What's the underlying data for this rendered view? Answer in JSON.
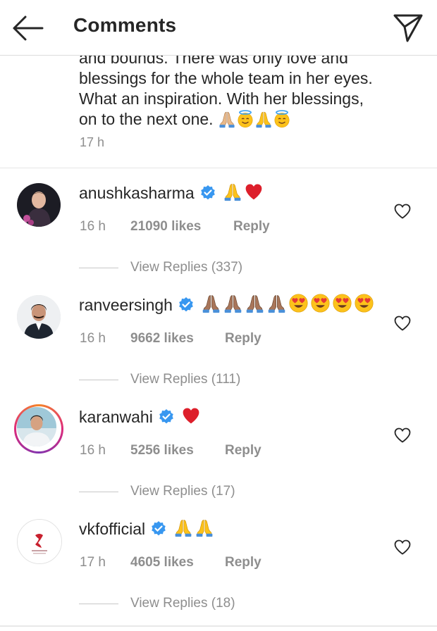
{
  "header": {
    "title": "Comments",
    "back_icon": "arrow-left-icon",
    "share_icon": "paper-plane-icon"
  },
  "caption": {
    "lines": [
      "and bounds. There was only love and",
      "blessings for the whole team in her eyes.",
      "What an inspiration. With her blessings,",
      "on to the next one."
    ],
    "emojis": [
      "folded-hands",
      "smiling-halo",
      "folded-hands",
      "smiling-halo"
    ],
    "time": "17 h"
  },
  "comments": [
    {
      "username": "anushkasharma",
      "verified": true,
      "emojis": [
        "folded-hands",
        "red-heart"
      ],
      "time": "16 h",
      "likes": "21090 likes",
      "reply": "Reply",
      "view_replies": "View Replies (337)"
    },
    {
      "username": "ranveersingh",
      "verified": true,
      "emojis": [
        "folded-hands-dark",
        "folded-hands-dark",
        "folded-hands-dark",
        "folded-hands-dark",
        "heart-eyes",
        "heart-eyes",
        "heart-eyes",
        "heart-eyes"
      ],
      "time": "16 h",
      "likes": "9662 likes",
      "reply": "Reply",
      "view_replies": "View Replies (111)"
    },
    {
      "username": "karanwahi",
      "verified": true,
      "emojis": [
        "red-heart"
      ],
      "time": "16 h",
      "likes": "5256 likes",
      "reply": "Reply",
      "view_replies": "View Replies (17)"
    },
    {
      "username": "vkfofficial",
      "verified": true,
      "emojis": [
        "folded-hands",
        "folded-hands"
      ],
      "time": "17 h",
      "likes": "4605 likes",
      "reply": "Reply",
      "view_replies": "View Replies (18)"
    }
  ],
  "colors": {
    "text": "#262626",
    "secondary": "#8e8e8e",
    "verified_blue": "#3897f0",
    "heart_red": "#e0245e",
    "emoji_yellow": "#fcc21b",
    "story_ring": "#dd2a7b"
  }
}
